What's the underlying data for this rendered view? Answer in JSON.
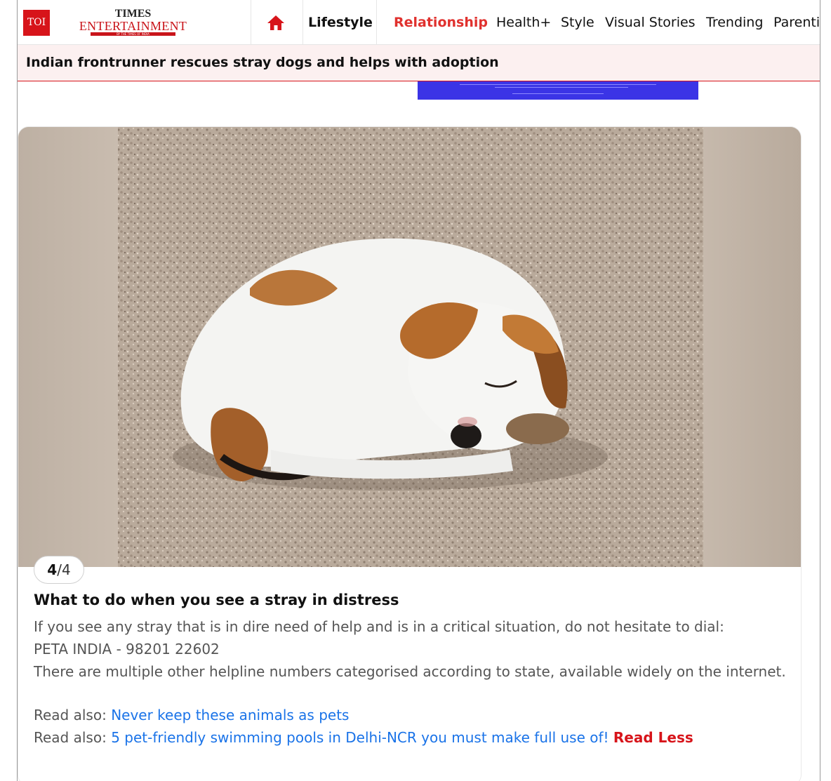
{
  "brand": {
    "toi": "TOI",
    "times": "TIMES",
    "entertainment": "ENTERTAINMENT",
    "tagline": "BY THE TIMES OF INDIA"
  },
  "nav": {
    "home_icon": "home-icon",
    "items": [
      "Lifestyle",
      "Relationship",
      "Health+",
      "Style",
      "Visual Stories",
      "Trending",
      "Parenti"
    ]
  },
  "headline": "Indian frontrunner rescues stray dogs and helps with adoption",
  "slide": {
    "current": "4",
    "total": "/4",
    "title": "What to do when you see a stray in distress",
    "paragraph1": "If you see any stray that is in dire need of help and is in a critical situation, do not hesitate to dial:",
    "paragraph1b": "PETA INDIA - 98201 22602",
    "paragraph2": "There are multiple other helpline numbers categorised according to state, available widely on the internet.",
    "read_also_label": "Read also:",
    "read_also_links": [
      "Never keep these animals as pets",
      "5 pet-friendly swimming pools in Delhi-NCR you must make full use of!"
    ],
    "read_less": "Read Less"
  },
  "colors": {
    "brand_red": "#d7141a",
    "active_nav": "#e0312e",
    "link_blue": "#1a73e8",
    "headline_bg": "#fcf0f0"
  }
}
